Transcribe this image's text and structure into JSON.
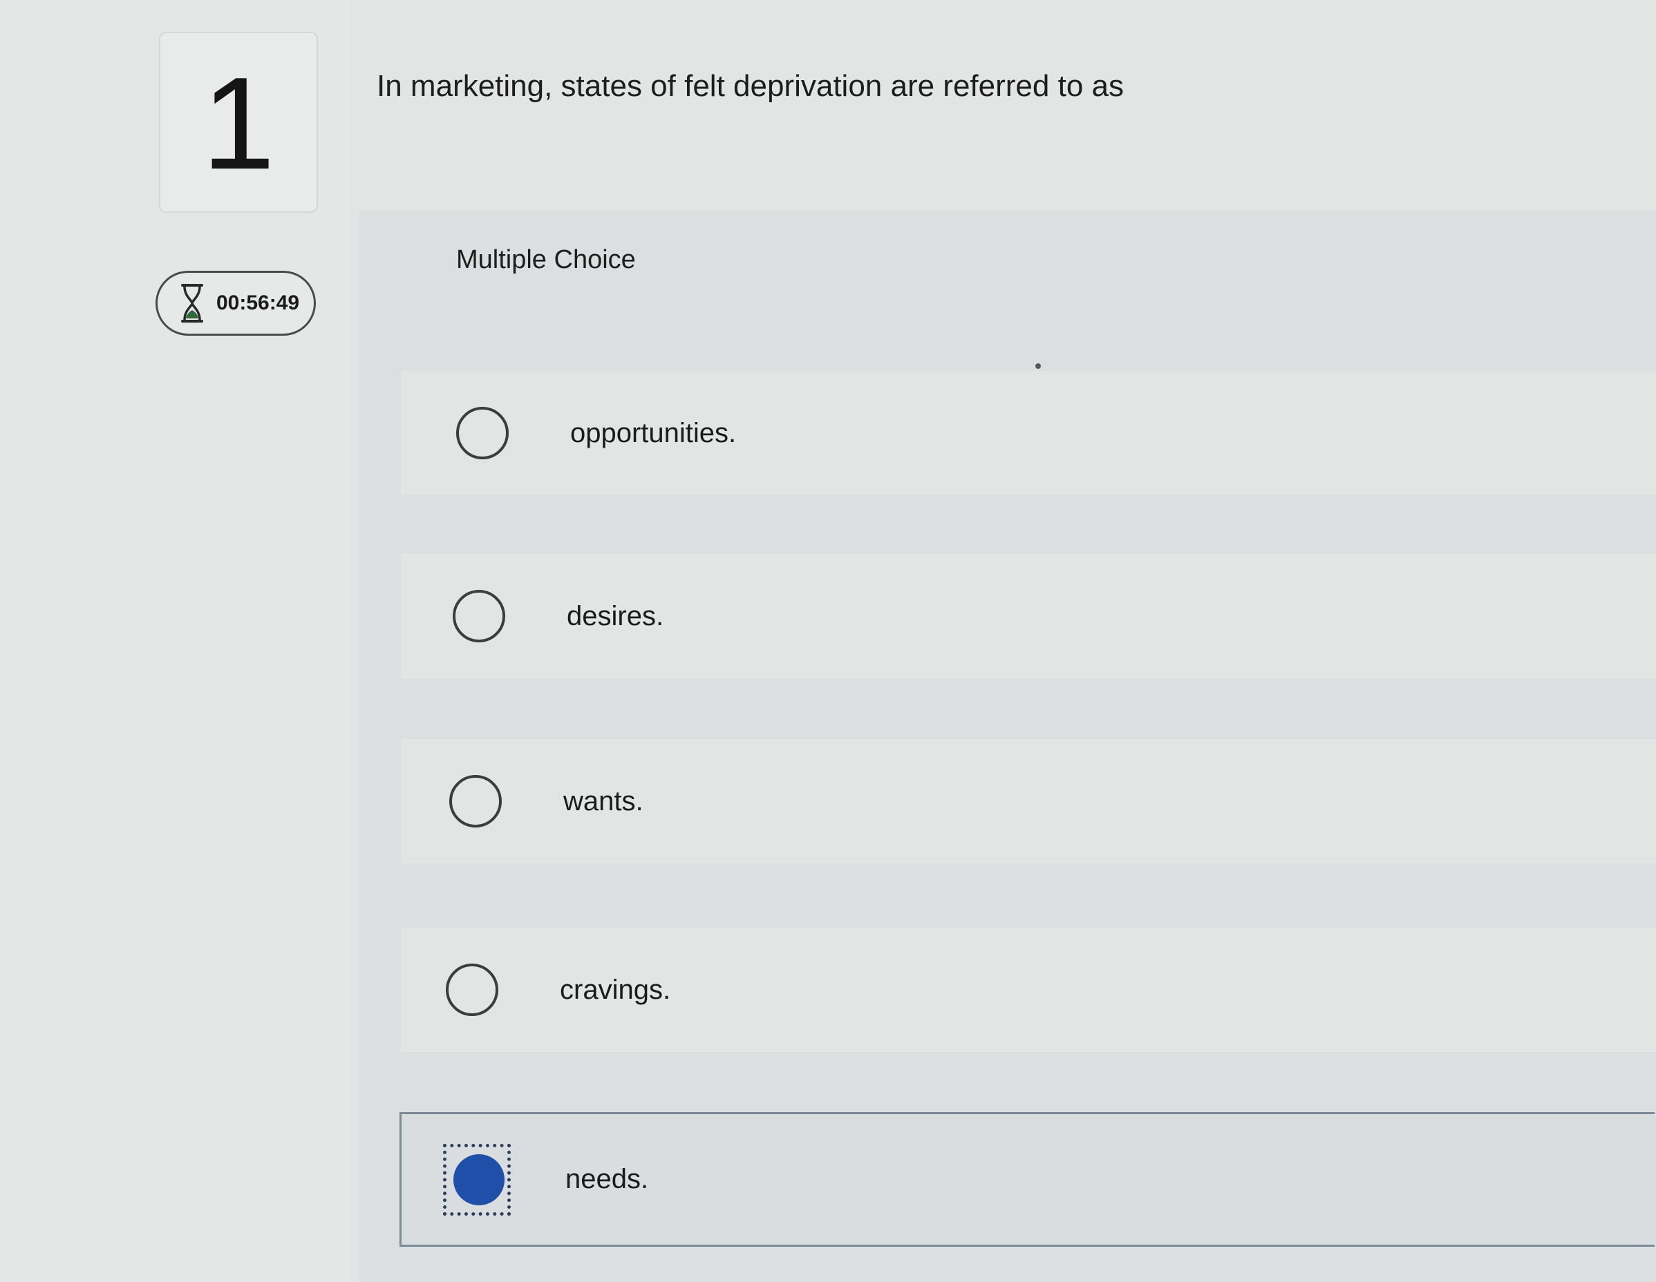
{
  "question": {
    "number": "1",
    "text": "In marketing, states of felt deprivation are referred to as"
  },
  "timer": {
    "icon": "hourglass-icon",
    "value": "00:56:49"
  },
  "question_type": "Multiple Choice",
  "options": [
    {
      "label": "opportunities.",
      "selected": false
    },
    {
      "label": "desires.",
      "selected": false
    },
    {
      "label": "wants.",
      "selected": false
    },
    {
      "label": "cravings.",
      "selected": false
    },
    {
      "label": "needs.",
      "selected": true
    }
  ],
  "colors": {
    "selected_radio": "#1f4fa8",
    "page_background": "#e3e5e4",
    "panel_background": "#dcdfdf"
  }
}
